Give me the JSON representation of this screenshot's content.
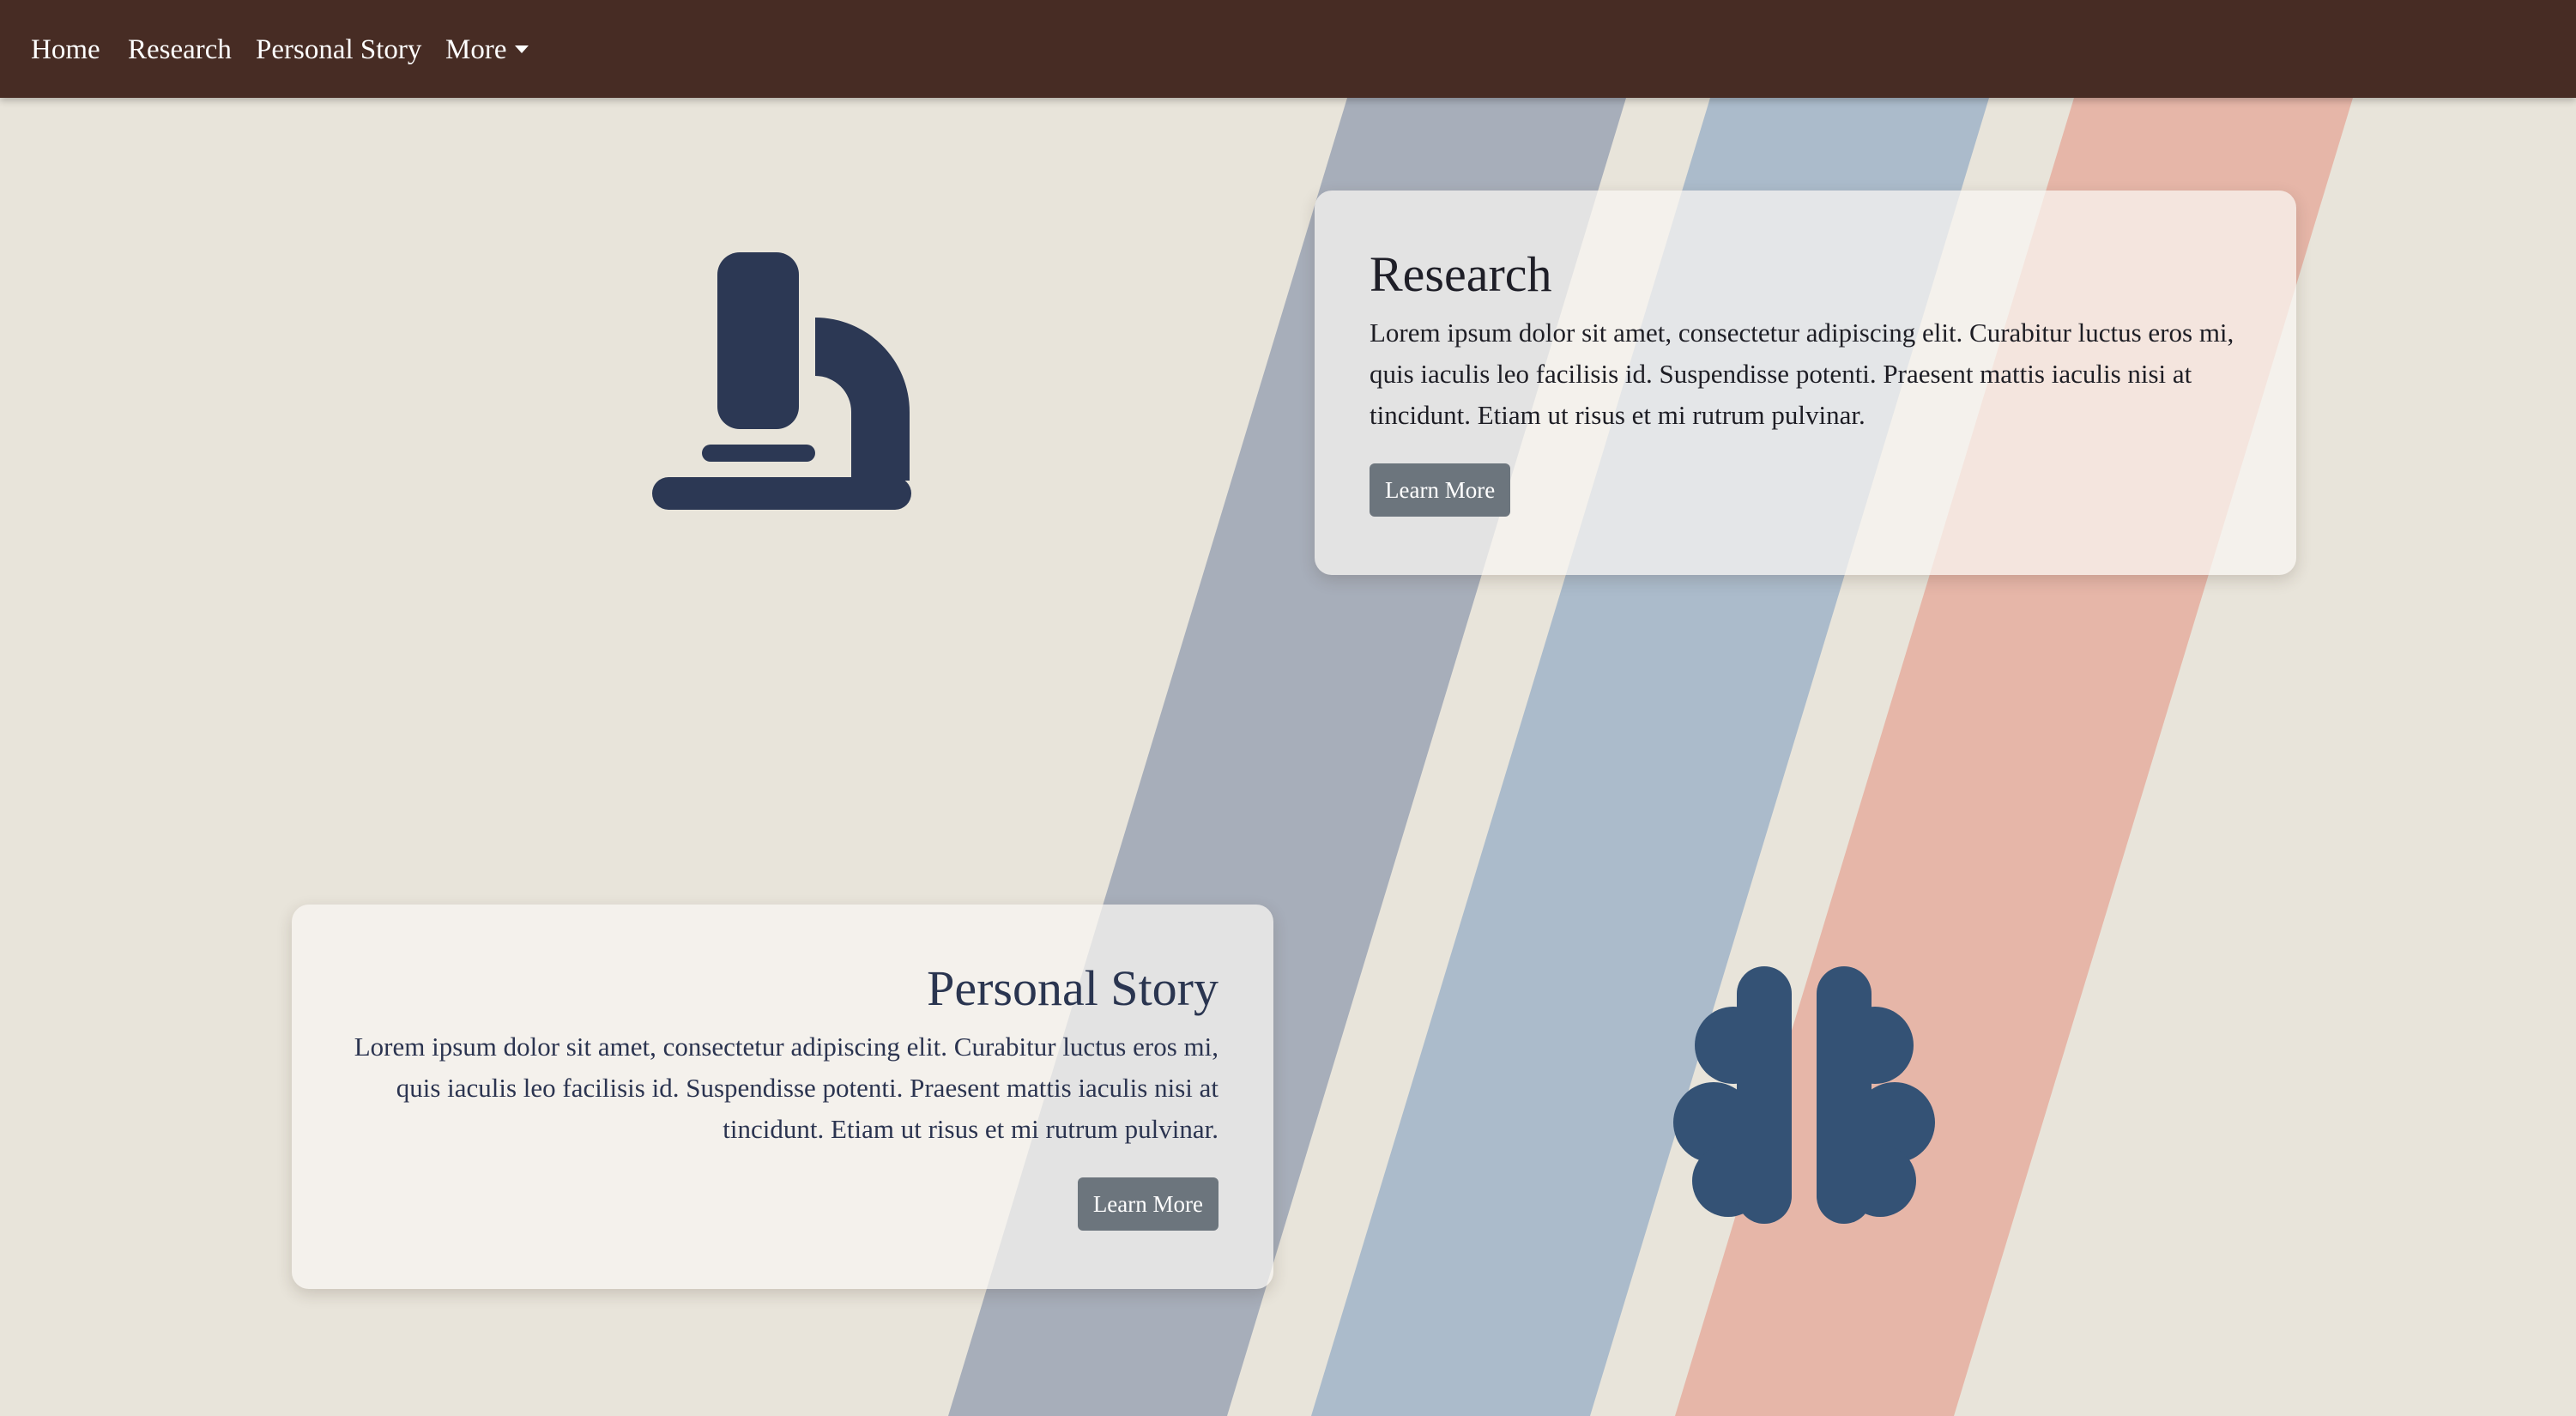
{
  "navbar": {
    "items": [
      {
        "label": "Home"
      },
      {
        "label": "Research"
      },
      {
        "label": "Personal Story"
      },
      {
        "label": "More"
      }
    ]
  },
  "sections": {
    "research": {
      "title": "Research",
      "text": "Lorem ipsum dolor sit amet, consectetur adipiscing elit. Curabitur luctus eros mi, quis iaculis leo facilisis id. Suspendisse potenti. Praesent mattis iaculis nisi at tincidunt. Etiam ut risus et mi rutrum pulvinar.",
      "button": "Learn More",
      "icon": "microscope-icon"
    },
    "personal_story": {
      "title": "Personal Story",
      "text": "Lorem ipsum dolor sit amet, consectetur adipiscing elit. Curabitur luctus eros mi, quis iaculis leo facilisis id. Suspendisse potenti. Praesent mattis iaculis nisi at tincidunt. Etiam ut risus et mi rutrum pulvinar.",
      "button": "Learn More",
      "icon": "brain-icon"
    }
  },
  "colors": {
    "navbar": "#472c24",
    "background": "#e8e4da",
    "stripe_gray": "#a7aeba",
    "stripe_blue": "#abbbcb",
    "stripe_salmon": "#e6b6a8",
    "icon_navy": "#2c3854",
    "icon_blue": "#345275",
    "button": "#6c757d"
  }
}
